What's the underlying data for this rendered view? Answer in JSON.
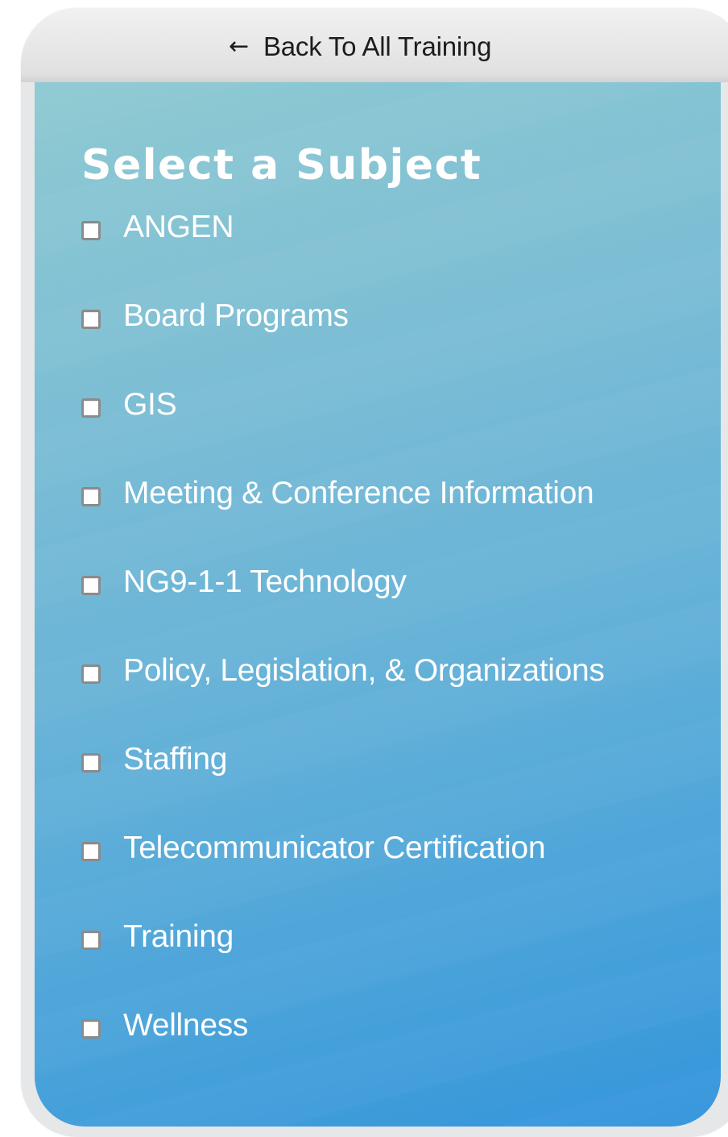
{
  "nav": {
    "back_arrow": "←",
    "back_label": "Back To All Training"
  },
  "filter": {
    "title": "Select a Subject",
    "items": [
      {
        "label": "ANGEN",
        "checked": false
      },
      {
        "label": "Board Programs",
        "checked": false
      },
      {
        "label": "GIS",
        "checked": false
      },
      {
        "label": "Meeting & Conference Information",
        "checked": false
      },
      {
        "label": "NG9-1-1 Technology",
        "checked": false
      },
      {
        "label": "Policy, Legislation, & Organizations",
        "checked": false
      },
      {
        "label": "Staffing",
        "checked": false
      },
      {
        "label": "Telecommunicator Certification",
        "checked": false
      },
      {
        "label": "Training",
        "checked": false
      },
      {
        "label": "Wellness",
        "checked": false
      }
    ]
  },
  "colors": {
    "panel_top": "#8ecad2",
    "panel_bottom": "#3495db",
    "frame": "#e6e7e8",
    "text": "#ffffff"
  }
}
